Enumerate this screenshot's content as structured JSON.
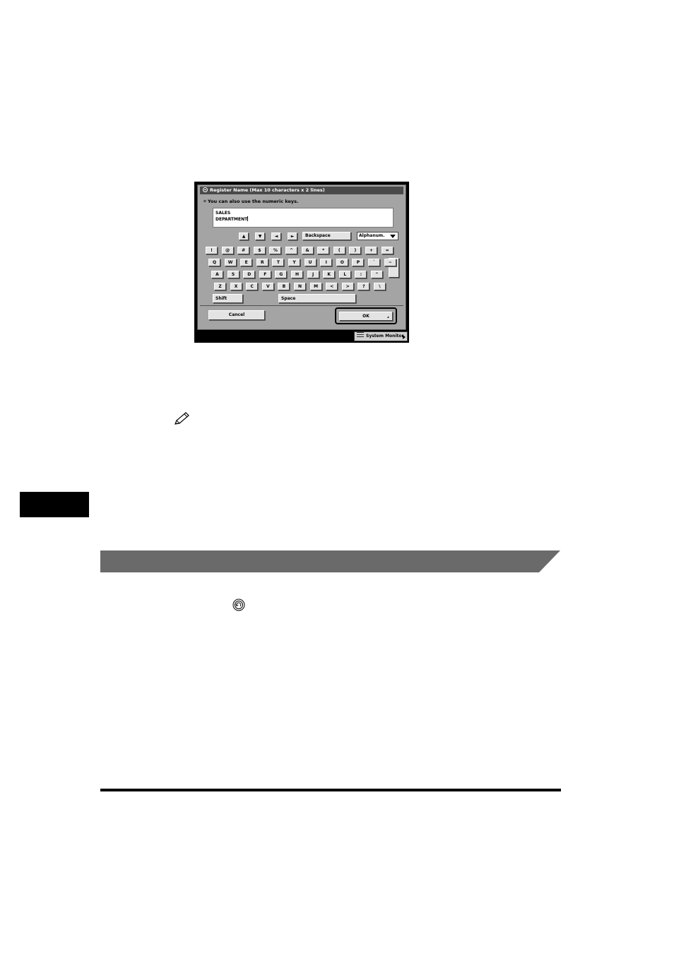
{
  "screen": {
    "title": "Register Name (Max 10 characters x 2 lines)",
    "hint": "You can also use the numeric keys.",
    "text_lines": [
      "SALES",
      "DEPARTMENT"
    ],
    "arrow_keys": [
      "▲",
      "▼",
      "◄",
      "►"
    ],
    "backspace_label": "Backspace",
    "mode_selected": "Alphanum.",
    "rows": [
      [
        "!",
        "@",
        "#",
        "$",
        "%",
        "^",
        "&",
        "*",
        "(",
        ")",
        "+",
        "="
      ],
      [
        "Q",
        "W",
        "E",
        "R",
        "T",
        "Y",
        "U",
        "I",
        "O",
        "P",
        "`",
        "~"
      ],
      [
        "A",
        "S",
        "D",
        "F",
        "G",
        "H",
        "J",
        "K",
        "L",
        ":",
        "\""
      ],
      [
        "Z",
        "X",
        "C",
        "V",
        "B",
        "N",
        "M",
        "<",
        ">",
        "?",
        "\\"
      ]
    ],
    "shift_label": "Shift",
    "space_label": "Space",
    "cancel_label": "Cancel",
    "ok_label": "OK",
    "system_monitor_label": "System Monitor"
  },
  "colors": {
    "panel": "#a4a4a4",
    "key": "#e3e3e3",
    "band": "#6a6a6a"
  }
}
